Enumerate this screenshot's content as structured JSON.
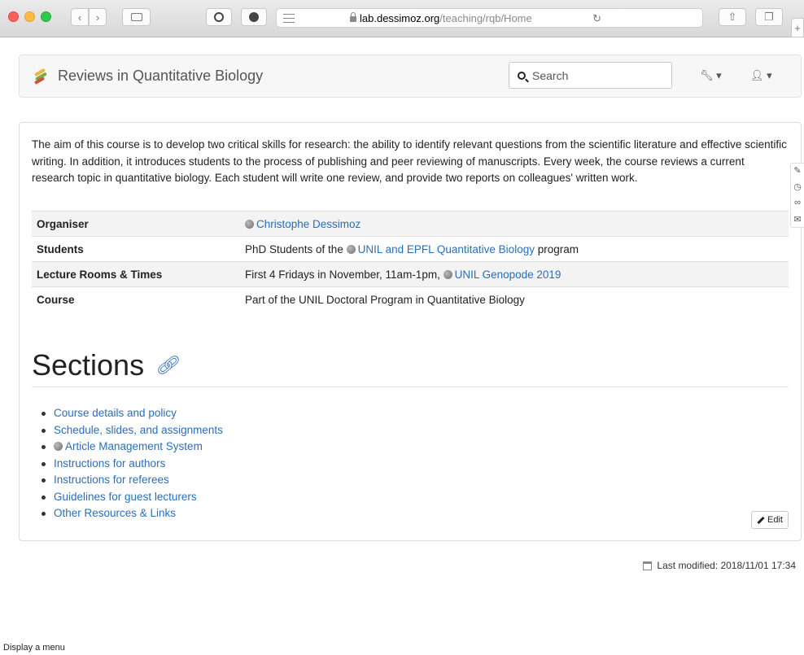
{
  "browser": {
    "url_host": "lab.dessimoz.org",
    "url_path": "/teaching/rqb/Home"
  },
  "navbar": {
    "title": "Reviews in Quantitative Biology",
    "search_placeholder": "Search"
  },
  "intro": "The aim of this course is to develop two critical skills for research: the ability to identify relevant questions from the scientific literature and effective scientific writing. In addition, it introduces students to the process of publishing and peer reviewing of manuscripts. Every week, the course reviews a current research topic in quantitative biology. Each student will write one review, and provide two reports on colleagues' written work.",
  "info": {
    "organiser_label": "Organiser",
    "organiser_link": "Christophe Dessimoz",
    "students_label": "Students",
    "students_pre": "PhD Students of the",
    "students_link": "UNIL and EPFL Quantitative Biology",
    "students_post": "program",
    "rooms_label": "Lecture Rooms & Times",
    "rooms_pre": "First 4 Fridays in November, 11am-1pm,",
    "rooms_link": "UNIL Genopode 2019",
    "course_label": "Course",
    "course_value": "Part of the UNIL Doctoral Program in Quantitative Biology"
  },
  "sections": {
    "heading": "Sections",
    "items": [
      "Course details and policy",
      "Schedule, slides, and assignments",
      "Article Management System",
      "Instructions for authors",
      "Instructions for referees",
      "Guidelines for guest lecturers",
      "Other Resources & Links"
    ]
  },
  "edit_label": "Edit",
  "last_modified": "Last modified: 2018/11/01 17:34",
  "status_bar": "Display a menu"
}
